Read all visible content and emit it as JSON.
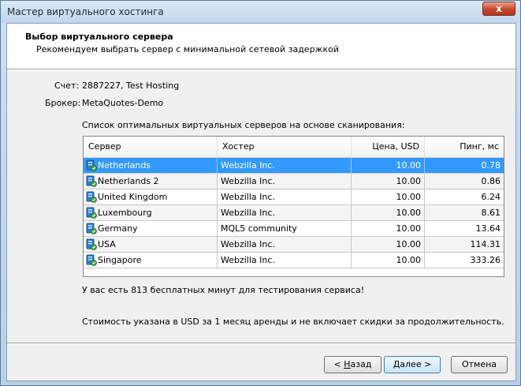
{
  "window": {
    "title": "Мастер виртуального хостинга",
    "close_label": "x"
  },
  "header": {
    "title": "Выбор виртуального сервера",
    "subtitle": "Рекомендуем выбрать сервер с минимальной сетевой задержкой"
  },
  "account": {
    "label": "Счет:",
    "value": "2887227, Test Hosting"
  },
  "broker": {
    "label": "Брокер:",
    "value": "MetaQuotes-Demo"
  },
  "list_caption": "Список оптимальных виртуальных серверов на основе сканирования:",
  "table": {
    "columns": [
      "Сервер",
      "Хостер",
      "Цена, USD",
      "Пинг, мс"
    ],
    "rows": [
      {
        "server": "Netherlands",
        "hoster": "Webzilla Inc.",
        "price": "10.00",
        "ping": "0.78"
      },
      {
        "server": "Netherlands 2",
        "hoster": "Webzilla Inc.",
        "price": "10.00",
        "ping": "0.86"
      },
      {
        "server": "United Kingdom",
        "hoster": "Webzilla Inc.",
        "price": "10.00",
        "ping": "6.24"
      },
      {
        "server": "Luxembourg",
        "hoster": "Webzilla Inc.",
        "price": "10.00",
        "ping": "8.61"
      },
      {
        "server": "Germany",
        "hoster": "MQL5 community",
        "price": "10.00",
        "ping": "13.64"
      },
      {
        "server": "USA",
        "hoster": "Webzilla Inc.",
        "price": "10.00",
        "ping": "114.31"
      },
      {
        "server": "Singapore",
        "hoster": "Webzilla Inc.",
        "price": "10.00",
        "ping": "333.26"
      }
    ],
    "selected_row": "Netherlands"
  },
  "free_minutes_note": "У вас есть 813 бесплатных минут для тестирования сервиса!",
  "price_note": "Стоимость указана в USD за 1 месяц аренды и не включает скидки за продолжительность.",
  "buttons": {
    "back": {
      "prefix": "< ",
      "mnemonic": "Н",
      "rest": "азад"
    },
    "next": {
      "prefix": "",
      "mnemonic": "Д",
      "rest": "алее >"
    },
    "cancel": "Отмена"
  },
  "colors": {
    "selection": "#3399ff",
    "icon_blue": "#2f7fd6",
    "icon_green": "#3aa832"
  }
}
